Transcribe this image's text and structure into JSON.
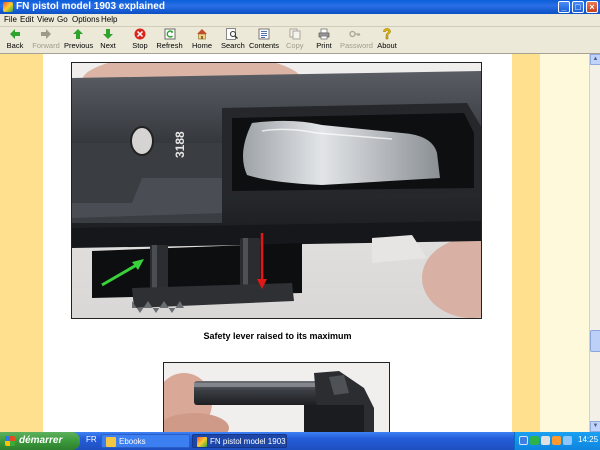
{
  "window": {
    "title": "FN pistol model 1903 explained",
    "minimize": "_",
    "maximize": "□",
    "close": "×"
  },
  "menu": [
    "File",
    "Edit",
    "View",
    "Go",
    "Options",
    "Help"
  ],
  "toolbar": [
    {
      "label": "Back",
      "icon": "back-arrow-icon",
      "enabled": true
    },
    {
      "label": "Forward",
      "icon": "forward-arrow-icon",
      "enabled": false
    },
    {
      "label": "Previous",
      "icon": "up-arrow-icon",
      "enabled": true
    },
    {
      "label": "Next",
      "icon": "down-arrow-icon",
      "enabled": true
    },
    {
      "label": "Stop",
      "icon": "stop-icon",
      "enabled": true
    },
    {
      "label": "Refresh",
      "icon": "refresh-icon",
      "enabled": true
    },
    {
      "label": "Home",
      "icon": "home-icon",
      "enabled": true
    },
    {
      "label": "Search",
      "icon": "search-icon",
      "enabled": true
    },
    {
      "label": "Contents",
      "icon": "contents-icon",
      "enabled": true
    },
    {
      "label": "Copy",
      "icon": "copy-icon",
      "enabled": false
    },
    {
      "label": "Print",
      "icon": "print-icon",
      "enabled": true
    },
    {
      "label": "Password",
      "icon": "key-icon",
      "enabled": false
    },
    {
      "label": "About",
      "icon": "about-icon",
      "enabled": true
    }
  ],
  "content": {
    "photo1_serial": "3188",
    "caption1": "Safety lever raised to its maximum"
  },
  "taskbar": {
    "start_label": "démarrer",
    "language": "FR",
    "tasks": [
      "Ebooks",
      "FN pistol model 1903 ..."
    ],
    "clock": "14:25"
  },
  "colors": {
    "page_margin": "#ffe08e",
    "page_margin_light": "#fff9dc",
    "taskbar": "#245edb",
    "start": "#3c9a3c",
    "titlebar": "#0a5fd8"
  }
}
